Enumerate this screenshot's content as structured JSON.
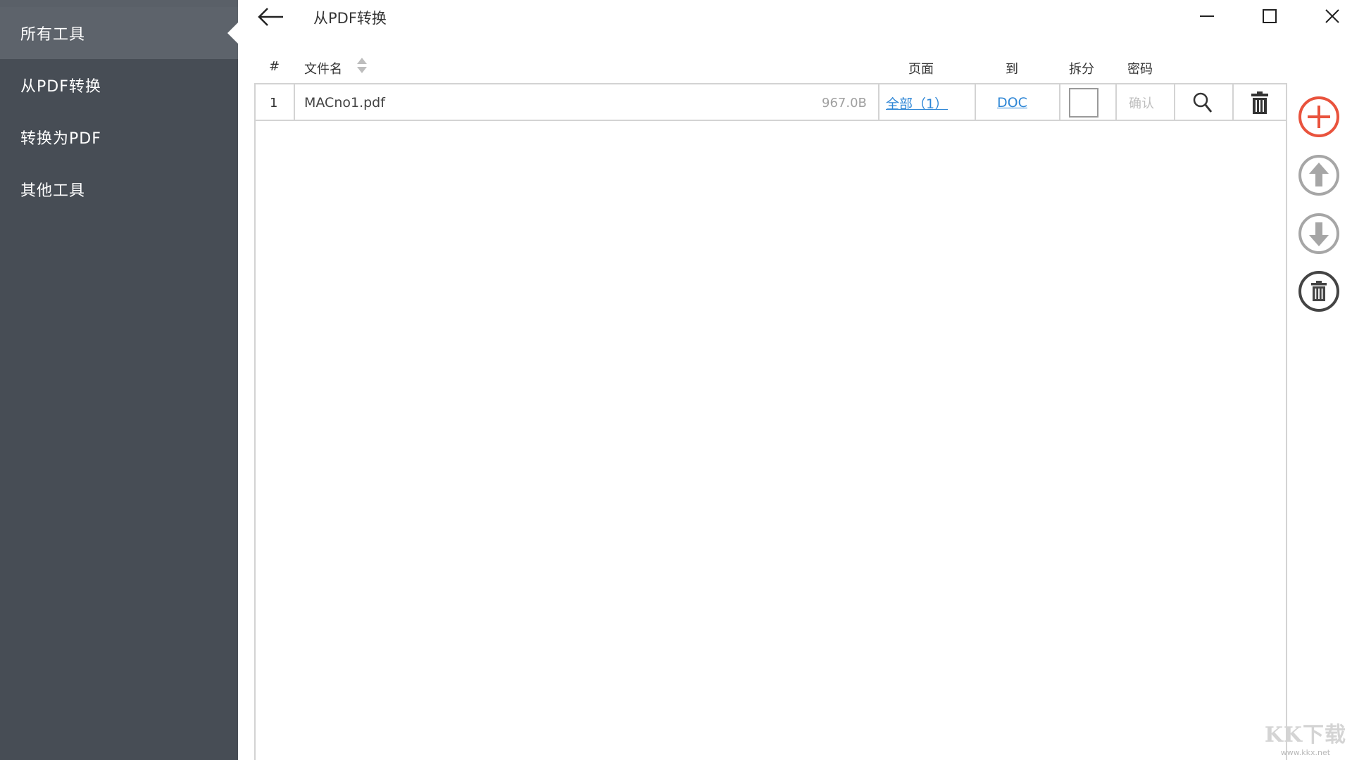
{
  "sidebar": {
    "items": [
      {
        "label": "所有工具",
        "active": true
      },
      {
        "label": "从PDF转换",
        "active": false
      },
      {
        "label": "转换为PDF",
        "active": false
      },
      {
        "label": "其他工具",
        "active": false
      }
    ]
  },
  "header": {
    "title": "从PDF转换",
    "back_icon": "arrow-left-icon",
    "window_controls": [
      "minimize-icon",
      "maximize-icon",
      "close-icon"
    ]
  },
  "table": {
    "columns": {
      "index": "#",
      "filename": "文件名",
      "pages": "页面",
      "to": "到",
      "split": "拆分",
      "password": "密码"
    },
    "rows": [
      {
        "index": "1",
        "filename": "MACno1.pdf",
        "size": "967.0B",
        "pages": "全部（1）",
        "format": "DOC",
        "split_checked": false,
        "password_placeholder": "确认"
      }
    ]
  },
  "actions": [
    "add-icon",
    "move-up-icon",
    "move-down-icon",
    "delete-all-icon"
  ],
  "colors": {
    "sidebar_bg": "#474d55",
    "sidebar_active": "#5d636b",
    "link": "#2d86d6",
    "add_accent": "#e9533d",
    "border": "#d3d3d3"
  },
  "watermark": {
    "big": "KK下载",
    "small": "www.kkx.net"
  }
}
